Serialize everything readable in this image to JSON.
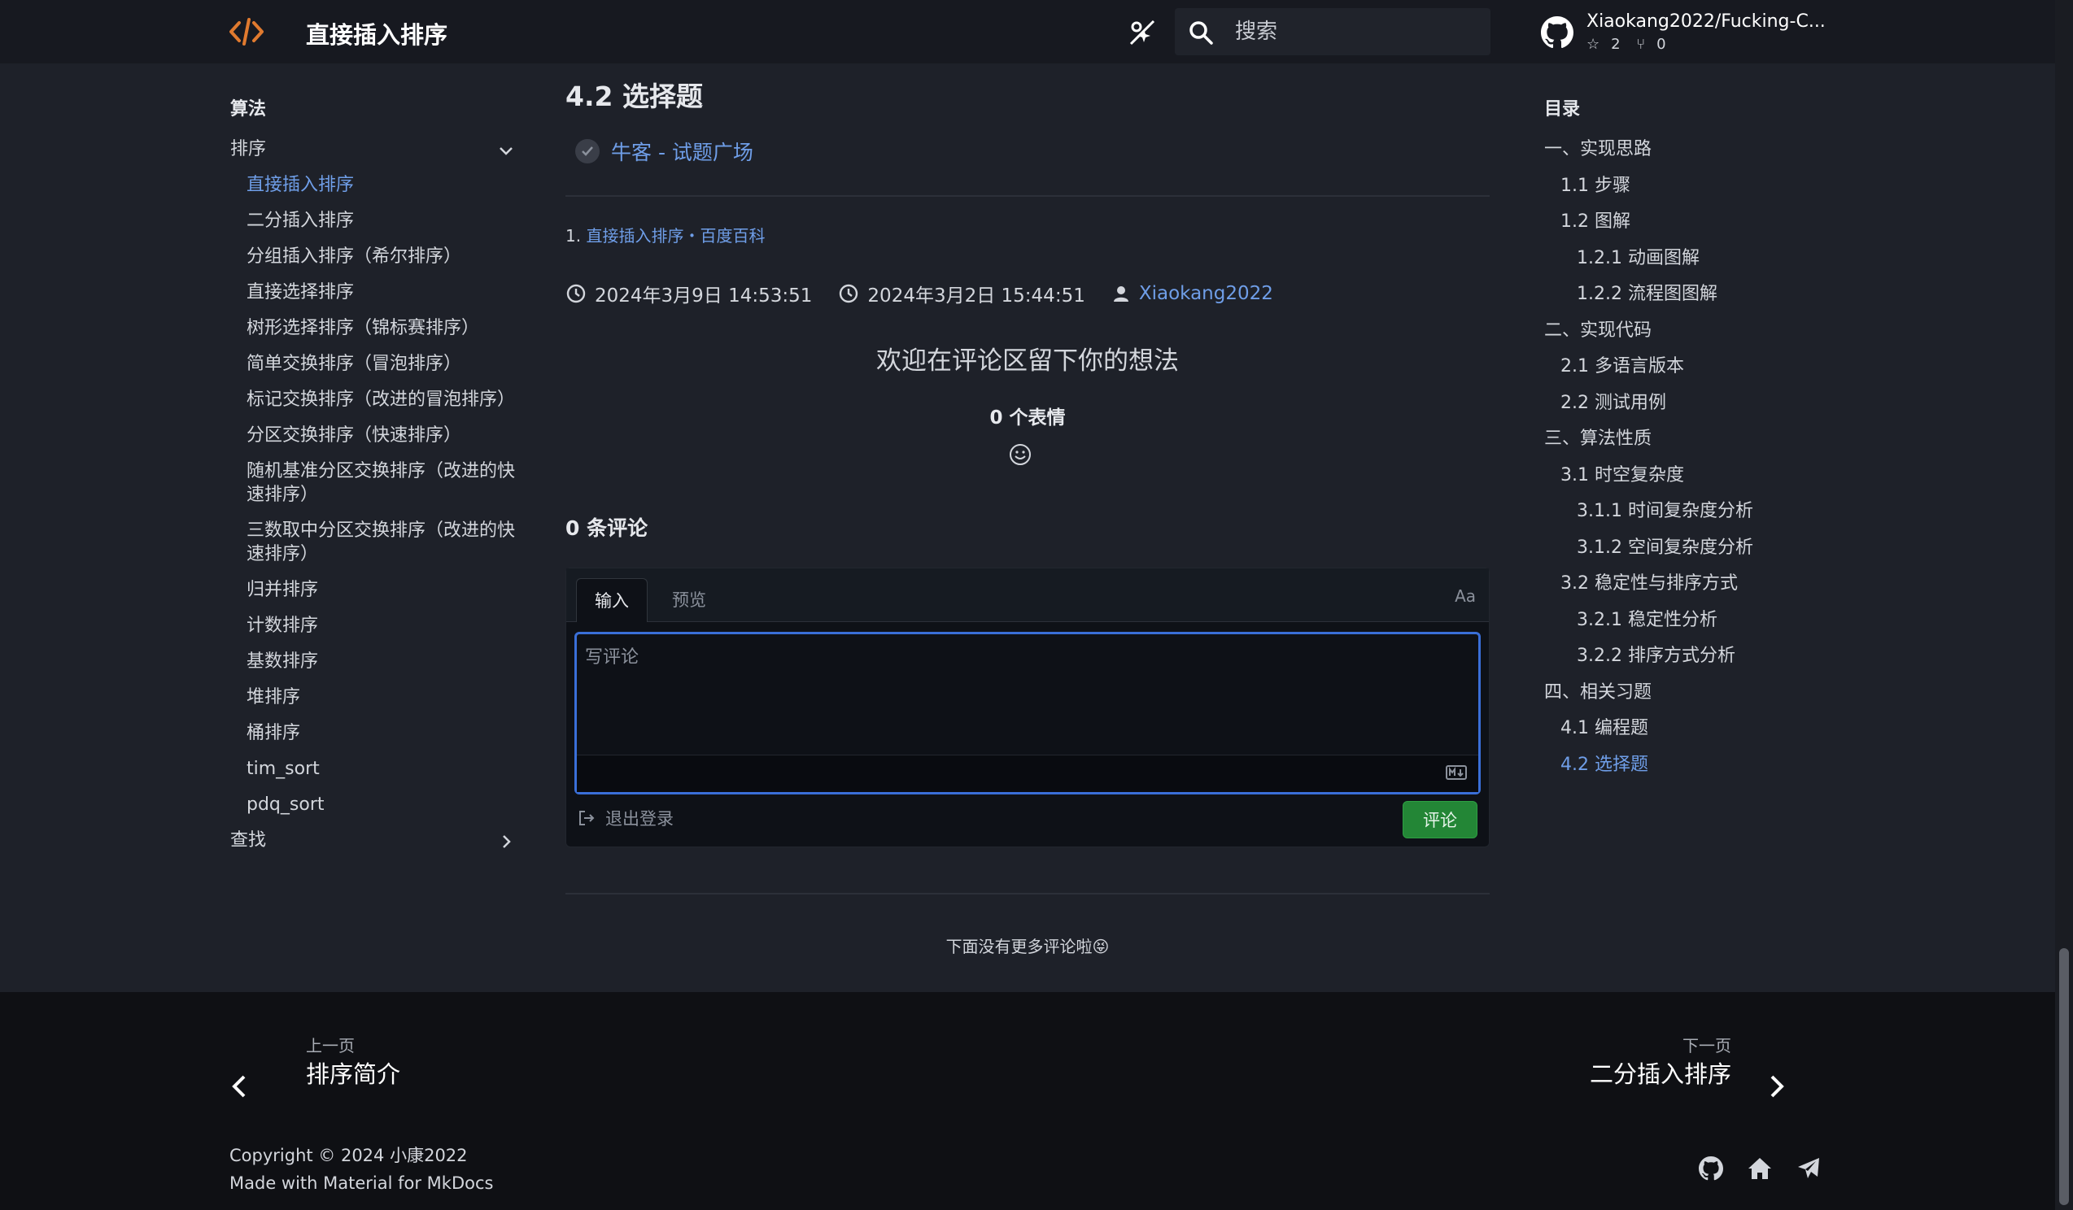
{
  "header": {
    "site_title": "直接插入排序",
    "search_placeholder": "搜索",
    "repo_name": "Xiaokang2022/Fucking-C...",
    "repo_stars": "2",
    "repo_forks": "0"
  },
  "nav": {
    "heading": "算法",
    "section_sort": "排序",
    "items": [
      "直接插入排序",
      "二分插入排序",
      "分组插入排序（希尔排序）",
      "直接选择排序",
      "树形选择排序（锦标赛排序）",
      "简单交换排序（冒泡排序）",
      "标记交换排序（改进的冒泡排序）",
      "分区交换排序（快速排序）",
      "随机基准分区交换排序（改进的快速排序）",
      "三数取中分区交换排序（改进的快速排序）",
      "归并排序",
      "计数排序",
      "基数排序",
      "堆排序",
      "桶排序",
      "tim_sort",
      "pdq_sort"
    ],
    "section_search": "查找"
  },
  "content": {
    "heading": "4.2 选择题",
    "task_link": "牛客 - 试题广场",
    "footnote_index": "1.",
    "footnote_link": "直接插入排序・百度百科",
    "updated_time": "2024年3月9日 14:53:51",
    "created_time": "2024年3月2日 15:44:51",
    "author": "Xiaokang2022"
  },
  "comments": {
    "title": "欢迎在评论区留下你的想法",
    "reactions": "0 个表情",
    "count": "0 条评论",
    "tab_write": "输入",
    "tab_preview": "预览",
    "font_toggle": "Aa",
    "placeholder": "写评论",
    "logout": "退出登录",
    "submit": "评论",
    "no_more": "下面没有更多评论啦😝"
  },
  "toc": {
    "heading": "目录",
    "items": [
      {
        "label": "一、实现思路",
        "level": 1
      },
      {
        "label": "1.1 步骤",
        "level": 2
      },
      {
        "label": "1.2 图解",
        "level": 2
      },
      {
        "label": "1.2.1 动画图解",
        "level": 3
      },
      {
        "label": "1.2.2 流程图图解",
        "level": 3
      },
      {
        "label": "二、实现代码",
        "level": 1
      },
      {
        "label": "2.1 多语言版本",
        "level": 2
      },
      {
        "label": "2.2 测试用例",
        "level": 2
      },
      {
        "label": "三、算法性质",
        "level": 1
      },
      {
        "label": "3.1 时空复杂度",
        "level": 2
      },
      {
        "label": "3.1.1 时间复杂度分析",
        "level": 3
      },
      {
        "label": "3.1.2 空间复杂度分析",
        "level": 3
      },
      {
        "label": "3.2 稳定性与排序方式",
        "level": 2
      },
      {
        "label": "3.2.1 稳定性分析",
        "level": 3
      },
      {
        "label": "3.2.2 排序方式分析",
        "level": 3
      },
      {
        "label": "四、相关习题",
        "level": 1
      },
      {
        "label": "4.1 编程题",
        "level": 2
      },
      {
        "label": "4.2 选择题",
        "level": 2
      }
    ]
  },
  "footer": {
    "prev_dir": "上一页",
    "prev_title": "排序简介",
    "next_dir": "下一页",
    "next_title": "二分插入排序",
    "copyright": "Copyright © 2024 小康2022",
    "made_with": "Made with Material for MkDocs"
  },
  "colors": {
    "accent": "#6f9ee8",
    "logo": "#e07a2f",
    "submit": "#238636",
    "focus_border": "#3a6fd8"
  }
}
